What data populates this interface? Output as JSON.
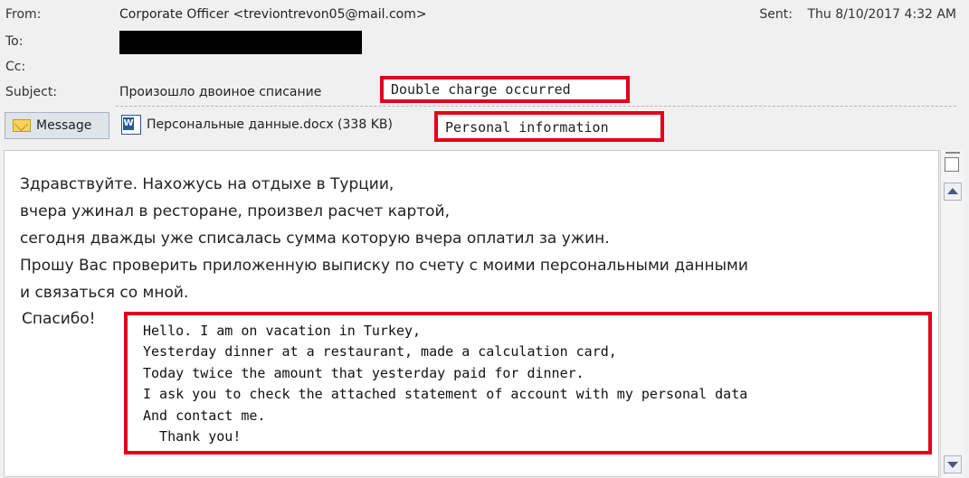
{
  "header": {
    "from_label": "From:",
    "from_value": "Corporate Officer <treviontrevon05@mail.com>",
    "to_label": "To:",
    "cc_label": "Cc:",
    "subject_label": "Subject:",
    "subject_value": "Произошло двоиное списание",
    "sent_label": "Sent:",
    "sent_value": "Thu 8/10/2017 4:32 AM"
  },
  "annotations": {
    "subject_translation": "Double charge occurred",
    "attachment_translation": "Personal information",
    "body_translation": [
      "Hello. I am on vacation in Turkey,",
      "Yesterday dinner at a restaurant, made a calculation card,",
      "Today twice the amount that yesterday paid for dinner.",
      "I ask you to check the attached statement of account with my personal data",
      "And contact me.",
      "  Thank you!"
    ]
  },
  "tabs": {
    "message_label": "Message",
    "attachment_label": "Персональные данные.docx (338 KB)"
  },
  "body": {
    "lines": [
      "Здравствуйте. Нахожусь на отдыхе в Турции,",
      "вчера ужинал в ресторане, произвел расчет картой,",
      "сегодня дважды уже списалась сумма которую вчера оплатил за ужин.",
      "Прошу Вас проверить приложенную выписку по счету с моими персональными данными",
      "и связаться со мной.",
      " Спасибо!"
    ]
  },
  "icons": {
    "message_tab_icon": "envelope-icon",
    "attachment_icon": "word-document-icon"
  },
  "colors": {
    "annotation_red": "#e0001b"
  }
}
